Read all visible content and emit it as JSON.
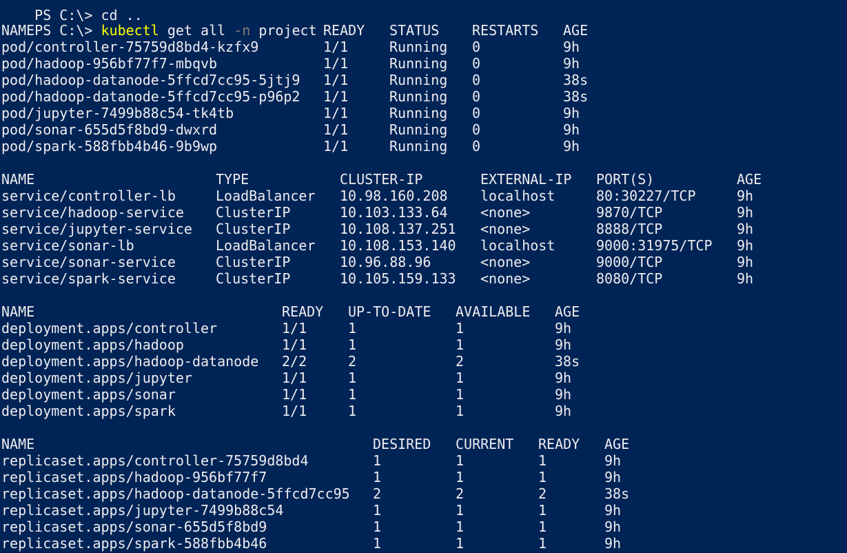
{
  "prompt": {
    "cut_line": "PS C:\\> cd ..",
    "ps": "PS C:\\>",
    "command": "kubectl",
    "args1": "get all",
    "flag": "-n",
    "args2": "project"
  },
  "pods": {
    "headers": [
      "NAME",
      "READY",
      "STATUS",
      "RESTARTS",
      "AGE"
    ],
    "rows": [
      [
        "pod/controller-75759d8bd4-kzfx9",
        "1/1",
        "Running",
        "0",
        "9h"
      ],
      [
        "pod/hadoop-956bf77f7-mbqvb",
        "1/1",
        "Running",
        "0",
        "9h"
      ],
      [
        "pod/hadoop-datanode-5ffcd7cc95-5jtj9",
        "1/1",
        "Running",
        "0",
        "38s"
      ],
      [
        "pod/hadoop-datanode-5ffcd7cc95-p96p2",
        "1/1",
        "Running",
        "0",
        "38s"
      ],
      [
        "pod/jupyter-7499b88c54-tk4tb",
        "1/1",
        "Running",
        "0",
        "9h"
      ],
      [
        "pod/sonar-655d5f8bd9-dwxrd",
        "1/1",
        "Running",
        "0",
        "9h"
      ],
      [
        "pod/spark-588fbb4b46-9b9wp",
        "1/1",
        "Running",
        "0",
        "9h"
      ]
    ]
  },
  "services": {
    "headers": [
      "NAME",
      "TYPE",
      "CLUSTER-IP",
      "EXTERNAL-IP",
      "PORT(S)",
      "AGE"
    ],
    "rows": [
      [
        "service/controller-lb",
        "LoadBalancer",
        "10.98.160.208",
        "localhost",
        "80:30227/TCP",
        "9h"
      ],
      [
        "service/hadoop-service",
        "ClusterIP",
        "10.103.133.64",
        "<none>",
        "9870/TCP",
        "9h"
      ],
      [
        "service/jupyter-service",
        "ClusterIP",
        "10.108.137.251",
        "<none>",
        "8888/TCP",
        "9h"
      ],
      [
        "service/sonar-lb",
        "LoadBalancer",
        "10.108.153.140",
        "localhost",
        "9000:31975/TCP",
        "9h"
      ],
      [
        "service/sonar-service",
        "ClusterIP",
        "10.96.88.96",
        "<none>",
        "9000/TCP",
        "9h"
      ],
      [
        "service/spark-service",
        "ClusterIP",
        "10.105.159.133",
        "<none>",
        "8080/TCP",
        "9h"
      ]
    ]
  },
  "deployments": {
    "headers": [
      "NAME",
      "READY",
      "UP-TO-DATE",
      "AVAILABLE",
      "AGE"
    ],
    "rows": [
      [
        "deployment.apps/controller",
        "1/1",
        "1",
        "1",
        "9h"
      ],
      [
        "deployment.apps/hadoop",
        "1/1",
        "1",
        "1",
        "9h"
      ],
      [
        "deployment.apps/hadoop-datanode",
        "2/2",
        "2",
        "2",
        "38s"
      ],
      [
        "deployment.apps/jupyter",
        "1/1",
        "1",
        "1",
        "9h"
      ],
      [
        "deployment.apps/sonar",
        "1/1",
        "1",
        "1",
        "9h"
      ],
      [
        "deployment.apps/spark",
        "1/1",
        "1",
        "1",
        "9h"
      ]
    ]
  },
  "replicasets": {
    "headers": [
      "NAME",
      "DESIRED",
      "CURRENT",
      "READY",
      "AGE"
    ],
    "rows": [
      [
        "replicaset.apps/controller-75759d8bd4",
        "1",
        "1",
        "1",
        "9h"
      ],
      [
        "replicaset.apps/hadoop-956bf77f7",
        "1",
        "1",
        "1",
        "9h"
      ],
      [
        "replicaset.apps/hadoop-datanode-5ffcd7cc95",
        "2",
        "2",
        "2",
        "38s"
      ],
      [
        "replicaset.apps/jupyter-7499b88c54",
        "1",
        "1",
        "1",
        "9h"
      ],
      [
        "replicaset.apps/sonar-655d5f8bd9",
        "1",
        "1",
        "1",
        "9h"
      ],
      [
        "replicaset.apps/spark-588fbb4b46",
        "1",
        "1",
        "1",
        "9h"
      ]
    ]
  },
  "colors": {
    "background": "#012456",
    "text": "#eeedf0",
    "command": "#ffff00",
    "flag": "#808080"
  }
}
